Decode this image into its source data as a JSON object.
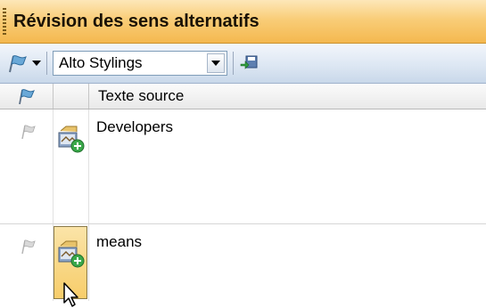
{
  "panel": {
    "title": "Révision des sens alternatifs"
  },
  "toolbar": {
    "flag_icon": "flag-icon",
    "combo_value": "Alto Stylings",
    "save_icon": "save-floppy-icon"
  },
  "grid": {
    "columns": [
      {
        "name": "flag",
        "label": ""
      },
      {
        "name": "status",
        "label": ""
      },
      {
        "name": "source",
        "label": "Texte source"
      }
    ],
    "rows": [
      {
        "source": "Developers",
        "flag_icon": "flag-gray-icon",
        "status_icon": "add-entry-icon",
        "selected": false
      },
      {
        "source": "means",
        "flag_icon": "flag-gray-icon",
        "status_icon": "add-entry-icon",
        "selected": true
      }
    ]
  },
  "colors": {
    "title_bar": "#f9cd78",
    "toolbar": "#dde7f3",
    "selection": "#f7cd6a"
  }
}
